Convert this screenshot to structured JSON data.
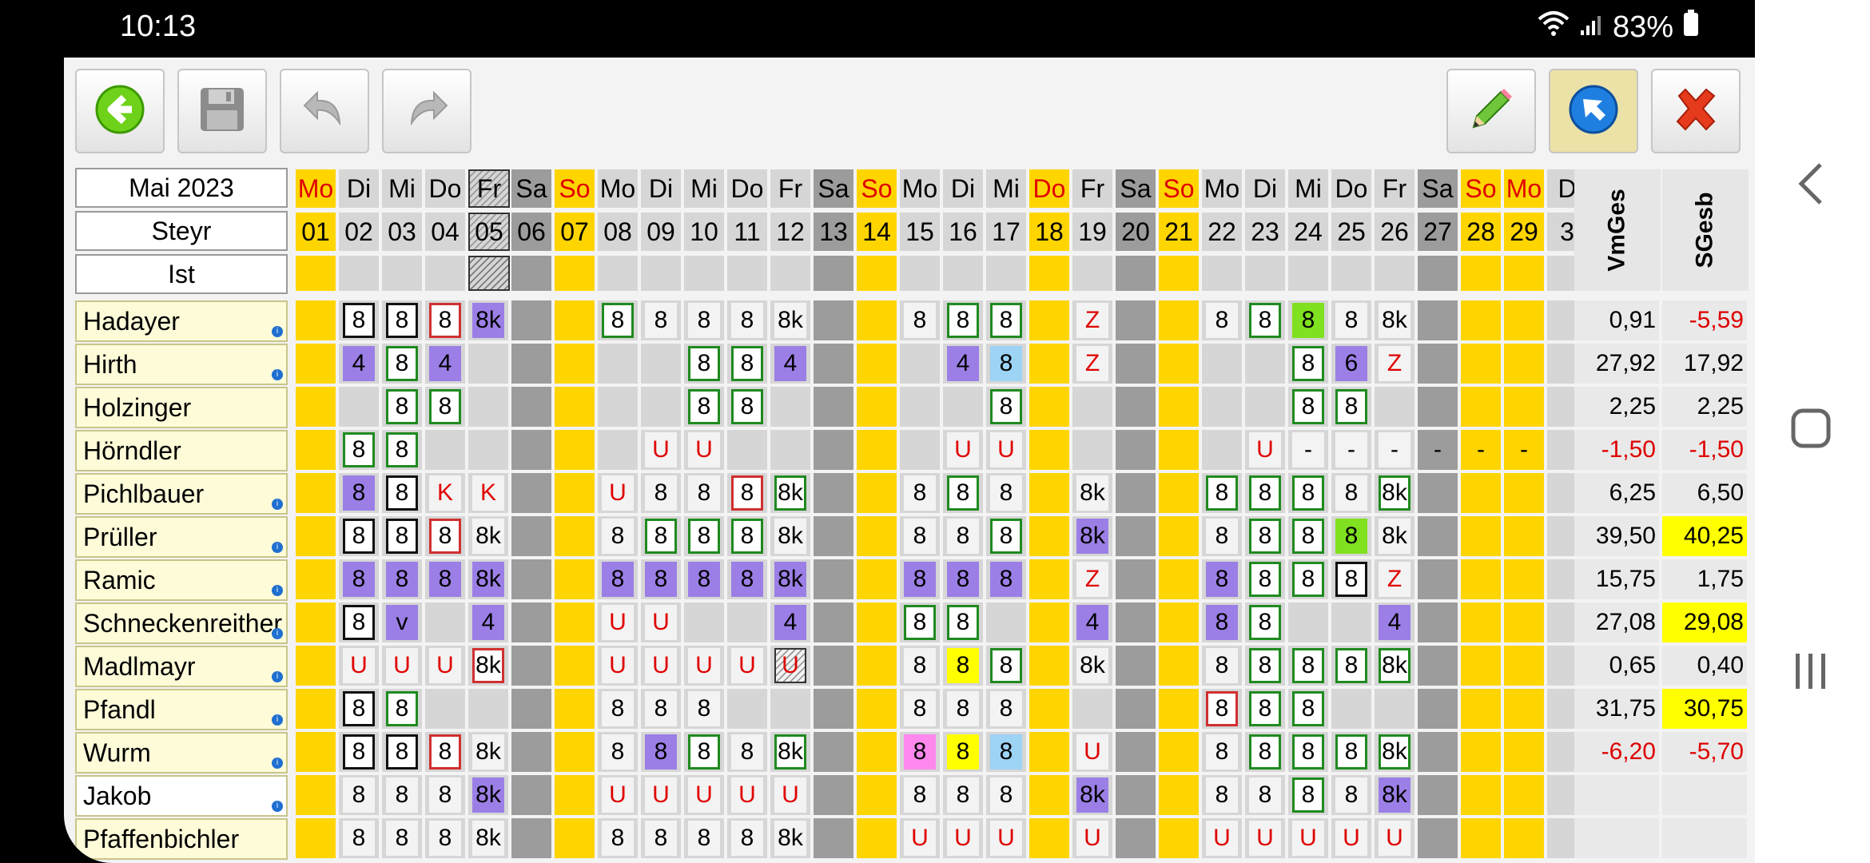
{
  "status": {
    "time": "10:13",
    "battery": "83%"
  },
  "toolbar": {
    "left": [
      {
        "name": "back-button",
        "icon": "back-arrow-icon"
      },
      {
        "name": "save-button",
        "icon": "floppy-icon"
      },
      {
        "name": "undo-button",
        "icon": "undo-icon"
      },
      {
        "name": "redo-button",
        "icon": "redo-icon"
      }
    ],
    "right": [
      {
        "name": "edit-button",
        "icon": "pencil-icon"
      },
      {
        "name": "select-button",
        "icon": "cursor-arrow-icon",
        "active": true
      },
      {
        "name": "close-button",
        "icon": "close-icon"
      }
    ]
  },
  "header": {
    "month": "Mai 2023",
    "location": "Steyr",
    "mode": "Ist"
  },
  "days": [
    {
      "wd": "Mo",
      "d": "01",
      "t": "hol"
    },
    {
      "wd": "Di",
      "d": "02",
      "t": "n"
    },
    {
      "wd": "Mi",
      "d": "03",
      "t": "n"
    },
    {
      "wd": "Do",
      "d": "04",
      "t": "n"
    },
    {
      "wd": "Fr",
      "d": "05",
      "t": "hatch"
    },
    {
      "wd": "Sa",
      "d": "06",
      "t": "sat"
    },
    {
      "wd": "So",
      "d": "07",
      "t": "sun"
    },
    {
      "wd": "Mo",
      "d": "08",
      "t": "n"
    },
    {
      "wd": "Di",
      "d": "09",
      "t": "n"
    },
    {
      "wd": "Mi",
      "d": "10",
      "t": "n"
    },
    {
      "wd": "Do",
      "d": "11",
      "t": "n"
    },
    {
      "wd": "Fr",
      "d": "12",
      "t": "n"
    },
    {
      "wd": "Sa",
      "d": "13",
      "t": "sat"
    },
    {
      "wd": "So",
      "d": "14",
      "t": "sun"
    },
    {
      "wd": "Mo",
      "d": "15",
      "t": "n"
    },
    {
      "wd": "Di",
      "d": "16",
      "t": "n"
    },
    {
      "wd": "Mi",
      "d": "17",
      "t": "n"
    },
    {
      "wd": "Do",
      "d": "18",
      "t": "hol"
    },
    {
      "wd": "Fr",
      "d": "19",
      "t": "n"
    },
    {
      "wd": "Sa",
      "d": "20",
      "t": "sat"
    },
    {
      "wd": "So",
      "d": "21",
      "t": "sun"
    },
    {
      "wd": "Mo",
      "d": "22",
      "t": "n"
    },
    {
      "wd": "Di",
      "d": "23",
      "t": "n"
    },
    {
      "wd": "Mi",
      "d": "24",
      "t": "n"
    },
    {
      "wd": "Do",
      "d": "25",
      "t": "n"
    },
    {
      "wd": "Fr",
      "d": "26",
      "t": "n"
    },
    {
      "wd": "Sa",
      "d": "27",
      "t": "sat"
    },
    {
      "wd": "So",
      "d": "28",
      "t": "sun"
    },
    {
      "wd": "Mo",
      "d": "29",
      "t": "hol"
    },
    {
      "wd": "D",
      "d": "3",
      "t": "n"
    }
  ],
  "summary_headers": [
    "VmGes",
    "SGesb"
  ],
  "employees": [
    {
      "name": "Hadayer",
      "info": true,
      "vm": "0,91",
      "sg": "-5,59",
      "vmc": "#000",
      "sgc": "#d00",
      "sgbg": ""
    },
    {
      "name": "Hirth",
      "info": true,
      "vm": "27,92",
      "sg": "17,92",
      "vmc": "#000",
      "sgc": "#000",
      "sgbg": ""
    },
    {
      "name": "Holzinger",
      "info": false,
      "vm": "2,25",
      "sg": "2,25",
      "vmc": "#000",
      "sgc": "#000",
      "sgbg": ""
    },
    {
      "name": "Hörndler",
      "info": false,
      "vm": "-1,50",
      "sg": "-1,50",
      "vmc": "#d00",
      "sgc": "#d00",
      "sgbg": ""
    },
    {
      "name": "Pichlbauer",
      "info": true,
      "vm": "6,25",
      "sg": "6,50",
      "vmc": "#000",
      "sgc": "#000",
      "sgbg": ""
    },
    {
      "name": "Prüller",
      "info": true,
      "vm": "39,50",
      "sg": "40,25",
      "vmc": "#000",
      "sgc": "#000",
      "sgbg": "#ffff00"
    },
    {
      "name": "Ramic",
      "info": true,
      "vm": "15,75",
      "sg": "1,75",
      "vmc": "#000",
      "sgc": "#000",
      "sgbg": ""
    },
    {
      "name": "Schneckenreither",
      "info": true,
      "vm": "27,08",
      "sg": "29,08",
      "vmc": "#000",
      "sgc": "#000",
      "sgbg": "#ffff00"
    },
    {
      "name": "Madlmayr",
      "info": true,
      "vm": "0,65",
      "sg": "0,40",
      "vmc": "#000",
      "sgc": "#000",
      "sgbg": ""
    },
    {
      "name": "Pfandl",
      "info": true,
      "vm": "31,75",
      "sg": "30,75",
      "vmc": "#000",
      "sgc": "#000",
      "sgbg": "#ffff00"
    },
    {
      "name": "Wurm",
      "info": true,
      "vm": "-6,20",
      "sg": "-5,70",
      "vmc": "#d00",
      "sgc": "#d00",
      "sgbg": ""
    },
    {
      "name": "Jakob",
      "info": true,
      "vm": "",
      "sg": "",
      "vmc": "#000",
      "sgc": "#000",
      "sgbg": ""
    },
    {
      "name": "Pfaffenbichler",
      "info": false,
      "vm": "",
      "sg": "",
      "vmc": "#000",
      "sgc": "#000",
      "sgbg": ""
    }
  ],
  "grid": [
    [
      "",
      "8",
      "8",
      "8",
      "8k",
      "",
      "",
      "8",
      "8",
      "8",
      "8",
      "8k",
      "",
      "",
      "8",
      "8",
      "8",
      "",
      "Z",
      "",
      "",
      "8",
      "8",
      "8",
      "8",
      "8k",
      "",
      "",
      "",
      ""
    ],
    [
      "",
      "4",
      "8",
      "4",
      "",
      "",
      "",
      "",
      "",
      "8",
      "8",
      "4",
      "",
      "",
      "",
      "4",
      "8",
      "",
      "Z",
      "",
      "",
      "",
      "",
      "8",
      "6",
      "Z",
      "",
      "",
      "",
      ""
    ],
    [
      "",
      "",
      "8",
      "8",
      "",
      "",
      "",
      "",
      "",
      "8",
      "8",
      "",
      "",
      "",
      "",
      "",
      "8",
      "",
      "",
      "",
      "",
      "",
      "",
      "8",
      "8",
      "",
      "",
      "",
      "",
      ""
    ],
    [
      "",
      "8",
      "8",
      "",
      "",
      "",
      "",
      "",
      "U",
      "U",
      "",
      "",
      "",
      "",
      "",
      "U",
      "U",
      "",
      "",
      "",
      "",
      "",
      "U",
      "-",
      "-",
      "-",
      "-",
      "-",
      "-",
      ""
    ],
    [
      "",
      "8",
      "8",
      "K",
      "K",
      "",
      "",
      "U",
      "8",
      "8",
      "8",
      "8k",
      "",
      "",
      "8",
      "8",
      "8",
      "",
      "8k",
      "",
      "",
      "8",
      "8",
      "8",
      "8",
      "8k",
      "",
      "",
      "",
      ""
    ],
    [
      "",
      "8",
      "8",
      "8",
      "8k",
      "",
      "",
      "8",
      "8",
      "8",
      "8",
      "8k",
      "",
      "",
      "8",
      "8",
      "8",
      "",
      "8k",
      "",
      "",
      "8",
      "8",
      "8",
      "8",
      "8k",
      "",
      "",
      "",
      ""
    ],
    [
      "",
      "8",
      "8",
      "8",
      "8k",
      "",
      "",
      "8",
      "8",
      "8",
      "8",
      "8k",
      "",
      "",
      "8",
      "8",
      "8",
      "",
      "Z",
      "",
      "",
      "8",
      "8",
      "8",
      "8",
      "Z",
      "",
      "",
      "",
      ""
    ],
    [
      "",
      "8",
      "v",
      "",
      "4",
      "",
      "",
      "U",
      "U",
      "",
      "",
      "4",
      "",
      "",
      "8",
      "8",
      "",
      "",
      "4",
      "",
      "",
      "8",
      "8",
      "",
      "",
      "4",
      "",
      "",
      "",
      ""
    ],
    [
      "",
      "U",
      "U",
      "U",
      "8k",
      "",
      "",
      "U",
      "U",
      "U",
      "U",
      "U",
      "",
      "",
      "8",
      "8",
      "8",
      "",
      "8k",
      "",
      "",
      "8",
      "8",
      "8",
      "8",
      "8k",
      "",
      "",
      "",
      ""
    ],
    [
      "",
      "8",
      "8",
      "",
      "",
      "",
      "",
      "8",
      "8",
      "8",
      "",
      "",
      "",
      "",
      "8",
      "8",
      "8",
      "",
      "",
      "",
      "",
      "8",
      "8",
      "8",
      "",
      "",
      "",
      "",
      "",
      ""
    ],
    [
      "",
      "8",
      "8",
      "8",
      "8k",
      "",
      "",
      "8",
      "8",
      "8",
      "8",
      "8k",
      "",
      "",
      "8",
      "8",
      "8",
      "",
      "U",
      "",
      "",
      "8",
      "8",
      "8",
      "8",
      "8k",
      "",
      "",
      "",
      ""
    ],
    [
      "",
      "8",
      "8",
      "8",
      "8k",
      "",
      "",
      "U",
      "U",
      "U",
      "U",
      "U",
      "",
      "",
      "8",
      "8",
      "8",
      "",
      "8k",
      "",
      "",
      "8",
      "8",
      "8",
      "8",
      "8k",
      "",
      "",
      "",
      ""
    ],
    [
      "",
      "8",
      "8",
      "8",
      "8k",
      "",
      "",
      "8",
      "8",
      "8",
      "8",
      "8k",
      "",
      "",
      "U",
      "U",
      "U",
      "",
      "U",
      "",
      "",
      "U",
      "U",
      "U",
      "U",
      "U",
      "",
      "",
      "",
      ""
    ]
  ],
  "styles": [
    [
      "",
      "bb",
      "bb",
      "br",
      "pu",
      "",
      "",
      "bg",
      "",
      "",
      "",
      "",
      "",
      "",
      "",
      "bg",
      "bg",
      "",
      "red",
      "",
      "",
      "",
      "bg",
      "lg",
      "",
      "",
      "",
      "",
      "",
      ""
    ],
    [
      "",
      "pu",
      "bg",
      "pu",
      "",
      "",
      "",
      "",
      "",
      "bg",
      "bg",
      "pu",
      "",
      "",
      "",
      "pu",
      "lb",
      "",
      "red",
      "",
      "",
      "",
      "",
      "bg",
      "pu",
      "red",
      "",
      "",
      "",
      ""
    ],
    [
      "",
      "",
      "bg",
      "bg",
      "",
      "",
      "",
      "",
      "",
      "bg",
      "bg",
      "",
      "",
      "",
      "",
      "",
      "bg",
      "",
      "",
      "",
      "",
      "",
      "",
      "bg",
      "bg",
      "",
      "",
      "",
      "",
      ""
    ],
    [
      "",
      "bg",
      "bg",
      "",
      "",
      "",
      "",
      "",
      "red",
      "red",
      "",
      "",
      "",
      "",
      "",
      "red",
      "red",
      "",
      "",
      "",
      "",
      "",
      "red",
      "",
      "",
      "",
      "",
      "",
      "",
      ""
    ],
    [
      "",
      "pu",
      "bb",
      "red",
      "red",
      "",
      "",
      "red",
      "",
      "",
      "br",
      "bg",
      "",
      "",
      "",
      "bg",
      "",
      "",
      "",
      "",
      "",
      "bg",
      "bg",
      "bg",
      "",
      "bg",
      "",
      "",
      "",
      ""
    ],
    [
      "",
      "bb",
      "bb",
      "br",
      "",
      "",
      "",
      "",
      "bg",
      "bg",
      "bg",
      "",
      "",
      "",
      "",
      "",
      "bg",
      "",
      "pu",
      "",
      "",
      "",
      "bg",
      "bg",
      "lg",
      "",
      "",
      "",
      "",
      ""
    ],
    [
      "",
      "pu",
      "pu",
      "pu",
      "pu",
      "",
      "",
      "pu",
      "pu",
      "pu",
      "pu",
      "pu",
      "",
      "",
      "pu",
      "pu",
      "pu",
      "",
      "red",
      "",
      "",
      "pu",
      "bg",
      "bg",
      "bb",
      "red",
      "",
      "",
      "",
      ""
    ],
    [
      "",
      "bb",
      "pu",
      "",
      "pu",
      "",
      "",
      "red",
      "red",
      "",
      "",
      "pu",
      "",
      "",
      "bg",
      "bg",
      "",
      "",
      "pu",
      "",
      "",
      "pu",
      "bg",
      "",
      "",
      "pu",
      "",
      "",
      "",
      ""
    ],
    [
      "",
      "red",
      "red",
      "red",
      "br",
      "",
      "",
      "red",
      "red",
      "red",
      "red",
      "hat",
      "",
      "",
      "",
      "ye",
      "bg",
      "",
      "",
      "",
      "",
      "",
      "bg",
      "bg",
      "bg",
      "bg",
      "",
      "",
      "",
      ""
    ],
    [
      "",
      "bb",
      "bg",
      "",
      "",
      "",
      "",
      "",
      "",
      "",
      "",
      "",
      "",
      "",
      "",
      "",
      "",
      "",
      "",
      "",
      "",
      "br",
      "bg",
      "bg",
      "",
      "",
      "",
      "",
      "",
      ""
    ],
    [
      "",
      "bb",
      "bb",
      "br",
      "",
      "",
      "",
      "",
      "pu",
      "bg",
      "",
      "bg",
      "",
      "",
      "pk",
      "ye",
      "lb",
      "",
      "red",
      "",
      "",
      "",
      "bg",
      "bg",
      "bg",
      "bg",
      "",
      "",
      "",
      ""
    ],
    [
      "",
      "",
      "",
      "",
      "pu",
      "",
      "",
      "red",
      "red",
      "red",
      "red",
      "red",
      "",
      "",
      "",
      "",
      "",
      "",
      "pu",
      "",
      "",
      "",
      "",
      "bg",
      "",
      "pu",
      "",
      "",
      "",
      ""
    ],
    [
      "",
      "",
      "",
      "",
      "",
      "",
      "",
      "",
      "",
      "",
      "",
      "",
      "",
      "",
      "red",
      "red",
      "red",
      "",
      "red",
      "",
      "",
      "red",
      "red",
      "red",
      "red",
      "red",
      "",
      "",
      "",
      ""
    ]
  ]
}
